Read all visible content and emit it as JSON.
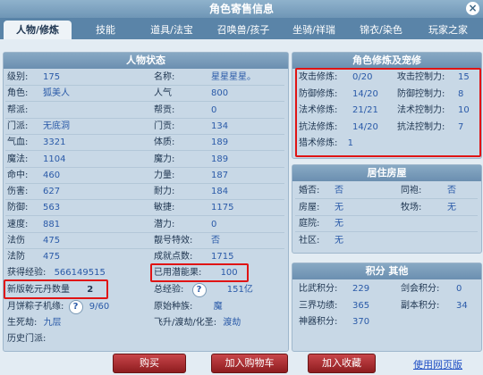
{
  "window": {
    "title": "角色寄售信息",
    "close": "×"
  },
  "tabs": [
    "人物/修炼",
    "技能",
    "道具/法宝",
    "召唤兽/孩子",
    "坐骑/祥瑞",
    "锦衣/染色",
    "玩家之家"
  ],
  "status_panel": {
    "title": "人物状态",
    "left": [
      {
        "label": "级别:",
        "value": "175"
      },
      {
        "label": "角色:",
        "value": "狐美人"
      },
      {
        "label": "帮派:",
        "value": ""
      },
      {
        "label": "门派:",
        "value": "无底洞"
      },
      {
        "label": "气血:",
        "value": "3321"
      },
      {
        "label": "魔法:",
        "value": "1104"
      },
      {
        "label": "命中:",
        "value": "460"
      },
      {
        "label": "伤害:",
        "value": "627"
      },
      {
        "label": "防御:",
        "value": "563"
      },
      {
        "label": "速度:",
        "value": "881"
      },
      {
        "label": "法伤",
        "value": "475"
      },
      {
        "label": "法防",
        "value": "475"
      }
    ],
    "right": [
      {
        "label": "名称:",
        "value": "星星星星。"
      },
      {
        "label": "人气",
        "value": "800"
      },
      {
        "label": "帮贡:",
        "value": "0"
      },
      {
        "label": "门贡:",
        "value": "134"
      },
      {
        "label": "体质:",
        "value": "189"
      },
      {
        "label": "魔力:",
        "value": "189"
      },
      {
        "label": "力量:",
        "value": "187"
      },
      {
        "label": "耐力:",
        "value": "184"
      },
      {
        "label": "敏捷:",
        "value": "1175"
      },
      {
        "label": "潜力:",
        "value": "0"
      },
      {
        "label": "靓号特效:",
        "value": "否"
      },
      {
        "label": "成就点数:",
        "value": "1715"
      }
    ],
    "exp_label": "获得经验:",
    "exp_value": "566149515",
    "potential_label": "已用潜能果:",
    "potential_value": "100",
    "fruit_label": "新版乾元丹数量",
    "fruit_value": "2",
    "total_exp_label": "总经验:",
    "total_exp_value": "151亿",
    "zongzi_label": "月饼粽子机缘:",
    "zongzi_value": "9/60",
    "race_label": "原始种族:",
    "race_value": "魔",
    "rebirth_label": "生死劫:",
    "rebirth_value": "九层",
    "fly_label": "飞升/渡劫/化圣:",
    "fly_value": "渡劫",
    "history_label": "历史门派:",
    "history_value": "",
    "help_glyph": "?"
  },
  "cultivation_panel": {
    "title": "角色修炼及宠修",
    "rows": [
      {
        "l": "攻击修炼:",
        "lv": "0/20",
        "r": "攻击控制力:",
        "rv": "15"
      },
      {
        "l": "防御修炼:",
        "lv": "14/20",
        "r": "防御控制力:",
        "rv": "8"
      },
      {
        "l": "法术修炼:",
        "lv": "21/21",
        "r": "法术控制力:",
        "rv": "10"
      },
      {
        "l": "抗法修炼:",
        "lv": "14/20",
        "r": "抗法控制力:",
        "rv": "7"
      }
    ],
    "hunt_label": "猎术修炼:",
    "hunt_value": "1"
  },
  "house_panel": {
    "title": "居住房屋",
    "rows": [
      {
        "l": "婚否:",
        "lv": "否",
        "r": "同袍:",
        "rv": "否"
      },
      {
        "l": "房屋:",
        "lv": "无",
        "r": "牧场:",
        "rv": "无"
      },
      {
        "l": "庭院:",
        "lv": "无",
        "r": "",
        "rv": ""
      },
      {
        "l": "社区:",
        "lv": "无",
        "r": "",
        "rv": ""
      }
    ]
  },
  "score_panel": {
    "title": "积分 其他",
    "rows": [
      {
        "l": "比武积分:",
        "lv": "229",
        "r": "剑会积分:",
        "rv": "0"
      },
      {
        "l": "三界功绩:",
        "lv": "365",
        "r": "副本积分:",
        "rv": "34"
      },
      {
        "l": "神器积分:",
        "lv": "370",
        "r": "",
        "rv": ""
      }
    ]
  },
  "buttons": {
    "buy": "购买",
    "cart": "加入购物车",
    "fav": "加入收藏",
    "web": "使用网页版"
  },
  "colors": {
    "highlight": "#e01414",
    "header": "#6b8fb0",
    "button": "#a8282c"
  }
}
